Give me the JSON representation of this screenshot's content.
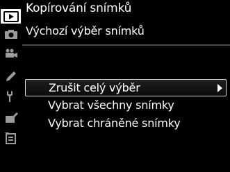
{
  "header": {
    "title": "Kopírování snímků",
    "subtitle": "Výchozí výběr snímků"
  },
  "sidebar": {
    "tabs": [
      {
        "icon": "play-icon",
        "active": true
      },
      {
        "icon": "camera-icon",
        "active": false
      },
      {
        "icon": "movie-camera-icon",
        "active": false
      },
      {
        "icon": "pencil-icon",
        "active": false
      },
      {
        "icon": "wrench-icon",
        "active": false
      },
      {
        "icon": "retouch-icon",
        "active": false
      },
      {
        "icon": "my-menu-icon",
        "active": false
      }
    ]
  },
  "menu": {
    "items": [
      {
        "label": "Zrušit celý výběr",
        "selected": true
      },
      {
        "label": "Vybrat všechny snímky",
        "selected": false
      },
      {
        "label": "Vybrat chráněné snímky",
        "selected": false
      }
    ]
  },
  "colors": {
    "background": "#000000",
    "active_tab": "#ffffff",
    "icon": "#9a9a9a",
    "divider": "#4a4a4a"
  }
}
